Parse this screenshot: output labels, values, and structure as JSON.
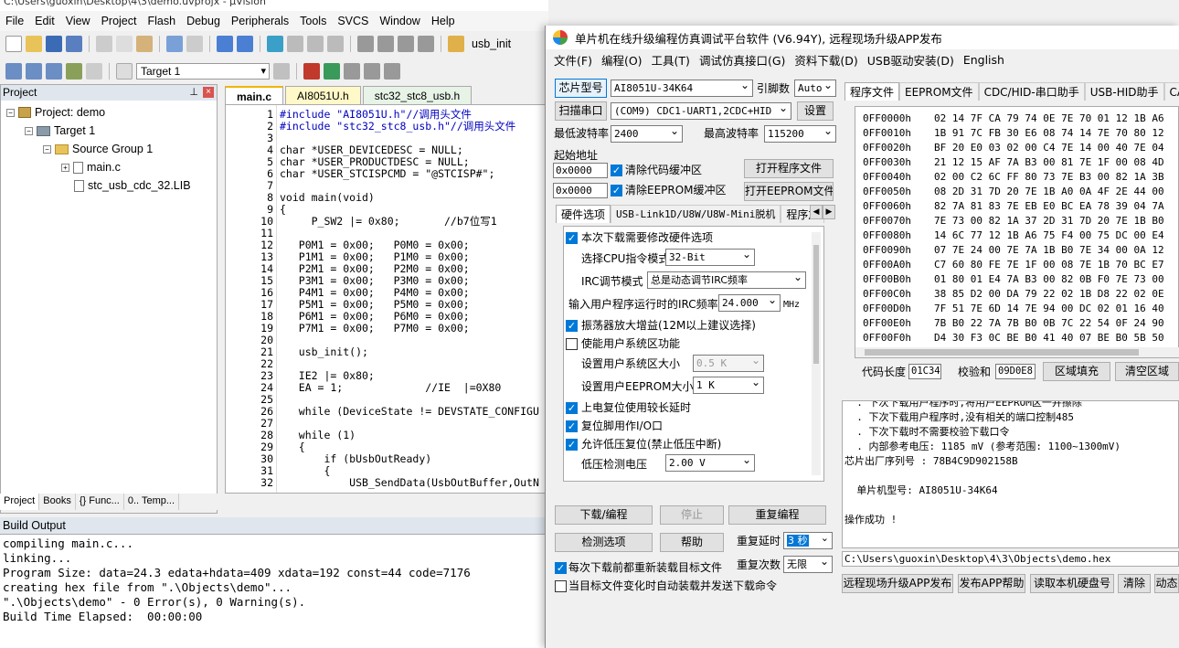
{
  "ide": {
    "title": "C:\\Users\\guoxin\\Desktop\\4\\3\\demo.uvprojx - µVision",
    "menu": [
      "File",
      "Edit",
      "View",
      "Project",
      "Flash",
      "Debug",
      "Peripherals",
      "Tools",
      "SVCS",
      "Window",
      "Help"
    ],
    "toolbar": {
      "function_combo": "usb_init",
      "target_combo": "Target 1"
    },
    "project_panel": {
      "title": "Project",
      "tree": {
        "project": "Project: demo",
        "target": "Target 1",
        "group": "Source Group 1",
        "files": [
          "main.c",
          "stc_usb_cdc_32.LIB"
        ]
      },
      "tabs": [
        "Project",
        "Books",
        "{} Func...",
        "0.. Temp..."
      ]
    },
    "editor": {
      "tabs": [
        "main.c",
        "AI8051U.h",
        "stc32_stc8_usb.h"
      ],
      "lines": [
        {
          "n": "1",
          "t": "#include \"AI8051U.h\"//调用头文件"
        },
        {
          "n": "2",
          "t": "#include \"stc32_stc8_usb.h\"//调用头文件"
        },
        {
          "n": "3",
          "t": ""
        },
        {
          "n": "4",
          "t": "char *USER_DEVICEDESC = NULL;"
        },
        {
          "n": "5",
          "t": "char *USER_PRODUCTDESC = NULL;"
        },
        {
          "n": "6",
          "t": "char *USER_STCISPCMD = \"@STCISP#\";"
        },
        {
          "n": "7",
          "t": ""
        },
        {
          "n": "8",
          "t": "void main(void)"
        },
        {
          "n": "9",
          "t": "{"
        },
        {
          "n": "10",
          "t": "     P_SW2 |= 0x80;       //b7位写1"
        },
        {
          "n": "11",
          "t": ""
        },
        {
          "n": "12",
          "t": "   P0M1 = 0x00;   P0M0 = 0x00;"
        },
        {
          "n": "13",
          "t": "   P1M1 = 0x00;   P1M0 = 0x00;"
        },
        {
          "n": "14",
          "t": "   P2M1 = 0x00;   P2M0 = 0x00;"
        },
        {
          "n": "15",
          "t": "   P3M1 = 0x00;   P3M0 = 0x00;"
        },
        {
          "n": "16",
          "t": "   P4M1 = 0x00;   P4M0 = 0x00;"
        },
        {
          "n": "17",
          "t": "   P5M1 = 0x00;   P5M0 = 0x00;"
        },
        {
          "n": "18",
          "t": "   P6M1 = 0x00;   P6M0 = 0x00;"
        },
        {
          "n": "19",
          "t": "   P7M1 = 0x00;   P7M0 = 0x00;"
        },
        {
          "n": "20",
          "t": ""
        },
        {
          "n": "21",
          "t": "   usb_init();"
        },
        {
          "n": "22",
          "t": ""
        },
        {
          "n": "23",
          "t": "   IE2 |= 0x80;"
        },
        {
          "n": "24",
          "t": "   EA = 1;             //IE  |=0X80"
        },
        {
          "n": "25",
          "t": ""
        },
        {
          "n": "26",
          "t": "   while (DeviceState != DEVSTATE_CONFIGU"
        },
        {
          "n": "27",
          "t": ""
        },
        {
          "n": "28",
          "t": "   while (1)"
        },
        {
          "n": "29",
          "t": "   {"
        },
        {
          "n": "30",
          "t": "       if (bUsbOutReady)"
        },
        {
          "n": "31",
          "t": "       {"
        },
        {
          "n": "32",
          "t": "           USB_SendData(UsbOutBuffer,OutN"
        }
      ]
    },
    "build": {
      "title": "Build Output",
      "lines": [
        "compiling main.c...",
        "linking...",
        "Program Size: data=24.3 edata+hdata=409 xdata=192 const=44 code=7176",
        "creating hex file from \".\\Objects\\demo\"...",
        "\".\\Objects\\demo\" - 0 Error(s), 0 Warning(s).",
        "Build Time Elapsed:  00:00:00"
      ]
    }
  },
  "isp": {
    "title": "单片机在线升级编程仿真调试平台软件 (V6.94Y), 远程现场升级APP发布",
    "menu": [
      "文件(F)",
      "编程(O)",
      "工具(T)",
      "调试仿真接口(G)",
      "资料下载(D)",
      "USB驱动安装(D)",
      "English"
    ],
    "chip_model_button": "芯片型号",
    "chip_model_value": "AI8051U-34K64",
    "pin_label": "引脚数",
    "pin_value": "Auto",
    "scan_port_button": "扫描串口",
    "port_value": "(COM9) CDC1-UART1,2CDC+HID",
    "settings_button": "设置",
    "min_baud_label": "最低波特率",
    "min_baud_value": "2400",
    "max_baud_label": "最高波特率",
    "max_baud_value": "115200",
    "start_addr_label": "起始地址",
    "start_addr_1": "0x0000",
    "start_addr_2": "0x0000",
    "clear_code_label": "清除代码缓冲区",
    "clear_eeprom_label": "清除EEPROM缓冲区",
    "open_program_button": "打开程序文件",
    "open_eeprom_button": "打开EEPROM文件",
    "option_tabs": [
      "硬件选项",
      "USB-Link1D/U8W/U8W-Mini脱机",
      "程序加"
    ],
    "hw": {
      "modify_hw_label": "本次下载需要修改硬件选项",
      "cpu_mode_label": "选择CPU指令模式",
      "cpu_mode_value": "32-Bit",
      "irc_mode_label": "IRC调节模式",
      "irc_mode_value": "总是动态调节IRC频率",
      "irc_freq_label": "输入用户程序运行时的IRC频率",
      "irc_freq_value": "24.000",
      "irc_freq_unit": "MHz",
      "osc_gain_label": "振荡器放大增益(12M以上建议选择)",
      "enable_sys_label": "使能用户系统区功能",
      "sys_size_label": "设置用户系统区大小",
      "sys_size_value": "0.5 K",
      "eeprom_size_label": "设置用户EEPROM大小",
      "eeprom_size_value": "1   K",
      "por_delay_label": "上电复位使用较长延时",
      "reset_io_label": "复位脚用作I/O口",
      "lvr_label": "允许低压复位(禁止低压中断)",
      "lvd_label": "低压检测电压",
      "lvd_value": "2.00 V"
    },
    "download_button": "下载/编程",
    "stop_button": "停止",
    "reprogram_button": "重复编程",
    "check_button": "检测选项",
    "help_button": "帮助",
    "repeat_delay_label": "重复延时",
    "repeat_delay_value": "3 秒",
    "repeat_count_label": "重复次数",
    "repeat_count_value": "无限",
    "reload_label": "每次下载前都重新装载目标文件",
    "auto_label": "当目标文件变化时自动装载并发送下载命令",
    "right_tabs": [
      "程序文件",
      "EEPROM文件",
      "CDC/HID-串口助手",
      "USB-HID助手",
      "CAN助手"
    ],
    "hex": {
      "rows": [
        {
          "a": "0FF0000h",
          "b": "02 14 7F CA 79 74 0E 7E 70 01 12 1B A6"
        },
        {
          "a": "0FF0010h",
          "b": "1B 91 7C FB 30 E6 08 74 14 7E 70 80 12"
        },
        {
          "a": "0FF0020h",
          "b": "BF 20 E0 03 02 00 C4 7E 14 00 40 7E 04"
        },
        {
          "a": "0FF0030h",
          "b": "21 12 15 AF 7A B3 00 81 7E 1F 00 08 4D"
        },
        {
          "a": "0FF0040h",
          "b": "02 00 C2 6C FF 80 73 7E B3 00 82 1A 3B"
        },
        {
          "a": "0FF0050h",
          "b": "08 2D 31 7D 20 7E 1B A0 0A 4F 2E 44 00"
        },
        {
          "a": "0FF0060h",
          "b": "82 7A 81 83 7E EB E0 BC EA 78 39 04 7A"
        },
        {
          "a": "0FF0070h",
          "b": "7E 73 00 82 1A 37 2D 31 7D 20 7E 1B B0"
        },
        {
          "a": "0FF0080h",
          "b": "14 6C 77 12 1B A6 75 F4 00 75 DC 00 E4"
        },
        {
          "a": "0FF0090h",
          "b": "07 7E 24 00 7E 7A 1B B0 7E 34 00 0A 12"
        },
        {
          "a": "0FF00A0h",
          "b": "C7 60 80 FE 7E 1F 00 08 7E 1B 70 BC E7"
        },
        {
          "a": "0FF00B0h",
          "b": "01 80 01 E4 7A B3 00 82 0B F0 7E 73 00"
        },
        {
          "a": "0FF00C0h",
          "b": "38 85 D2 00 DA 79 22 02 1B D8 22 02 0E"
        },
        {
          "a": "0FF00D0h",
          "b": "7F 51 7E 6D 14 7E 94 00 DC 02 01 16 40"
        },
        {
          "a": "0FF00E0h",
          "b": "7B B0 22 7A 7B B0 0B 7C 22 54 0F 24 90"
        },
        {
          "a": "0FF00F0h",
          "b": "D4 30 F3 0C BE B0 41 40 07 BE B0 5B 50"
        }
      ]
    },
    "code_len_label": "代码长度",
    "code_len_value": "01C34",
    "checksum_label": "校验和",
    "checksum_value": "09D0E8",
    "fill_button": "区域填充",
    "clear_area_button": "清空区域",
    "log": [
      "  . 下次下载用户程序时,将用户EEPROM区一并擦除",
      "  . 下次下载用户程序时,没有相关的端口控制485",
      "  . 下次下载时不需要校验下载口令",
      "  . 内部参考电压: 1185 mV (参考范围: 1100~1300mV)",
      "芯片出厂序列号 : 78B4C9D902158B",
      "",
      "  单片机型号: AI8051U-34K64",
      "",
      "操作成功 !"
    ],
    "file_path": "C:\\Users\\guoxin\\Desktop\\4\\3\\Objects\\demo.hex",
    "bottom_buttons": [
      "远程现场升级APP发布",
      "发布APP帮助",
      "读取本机硬盘号",
      "清除",
      "动态"
    ]
  }
}
